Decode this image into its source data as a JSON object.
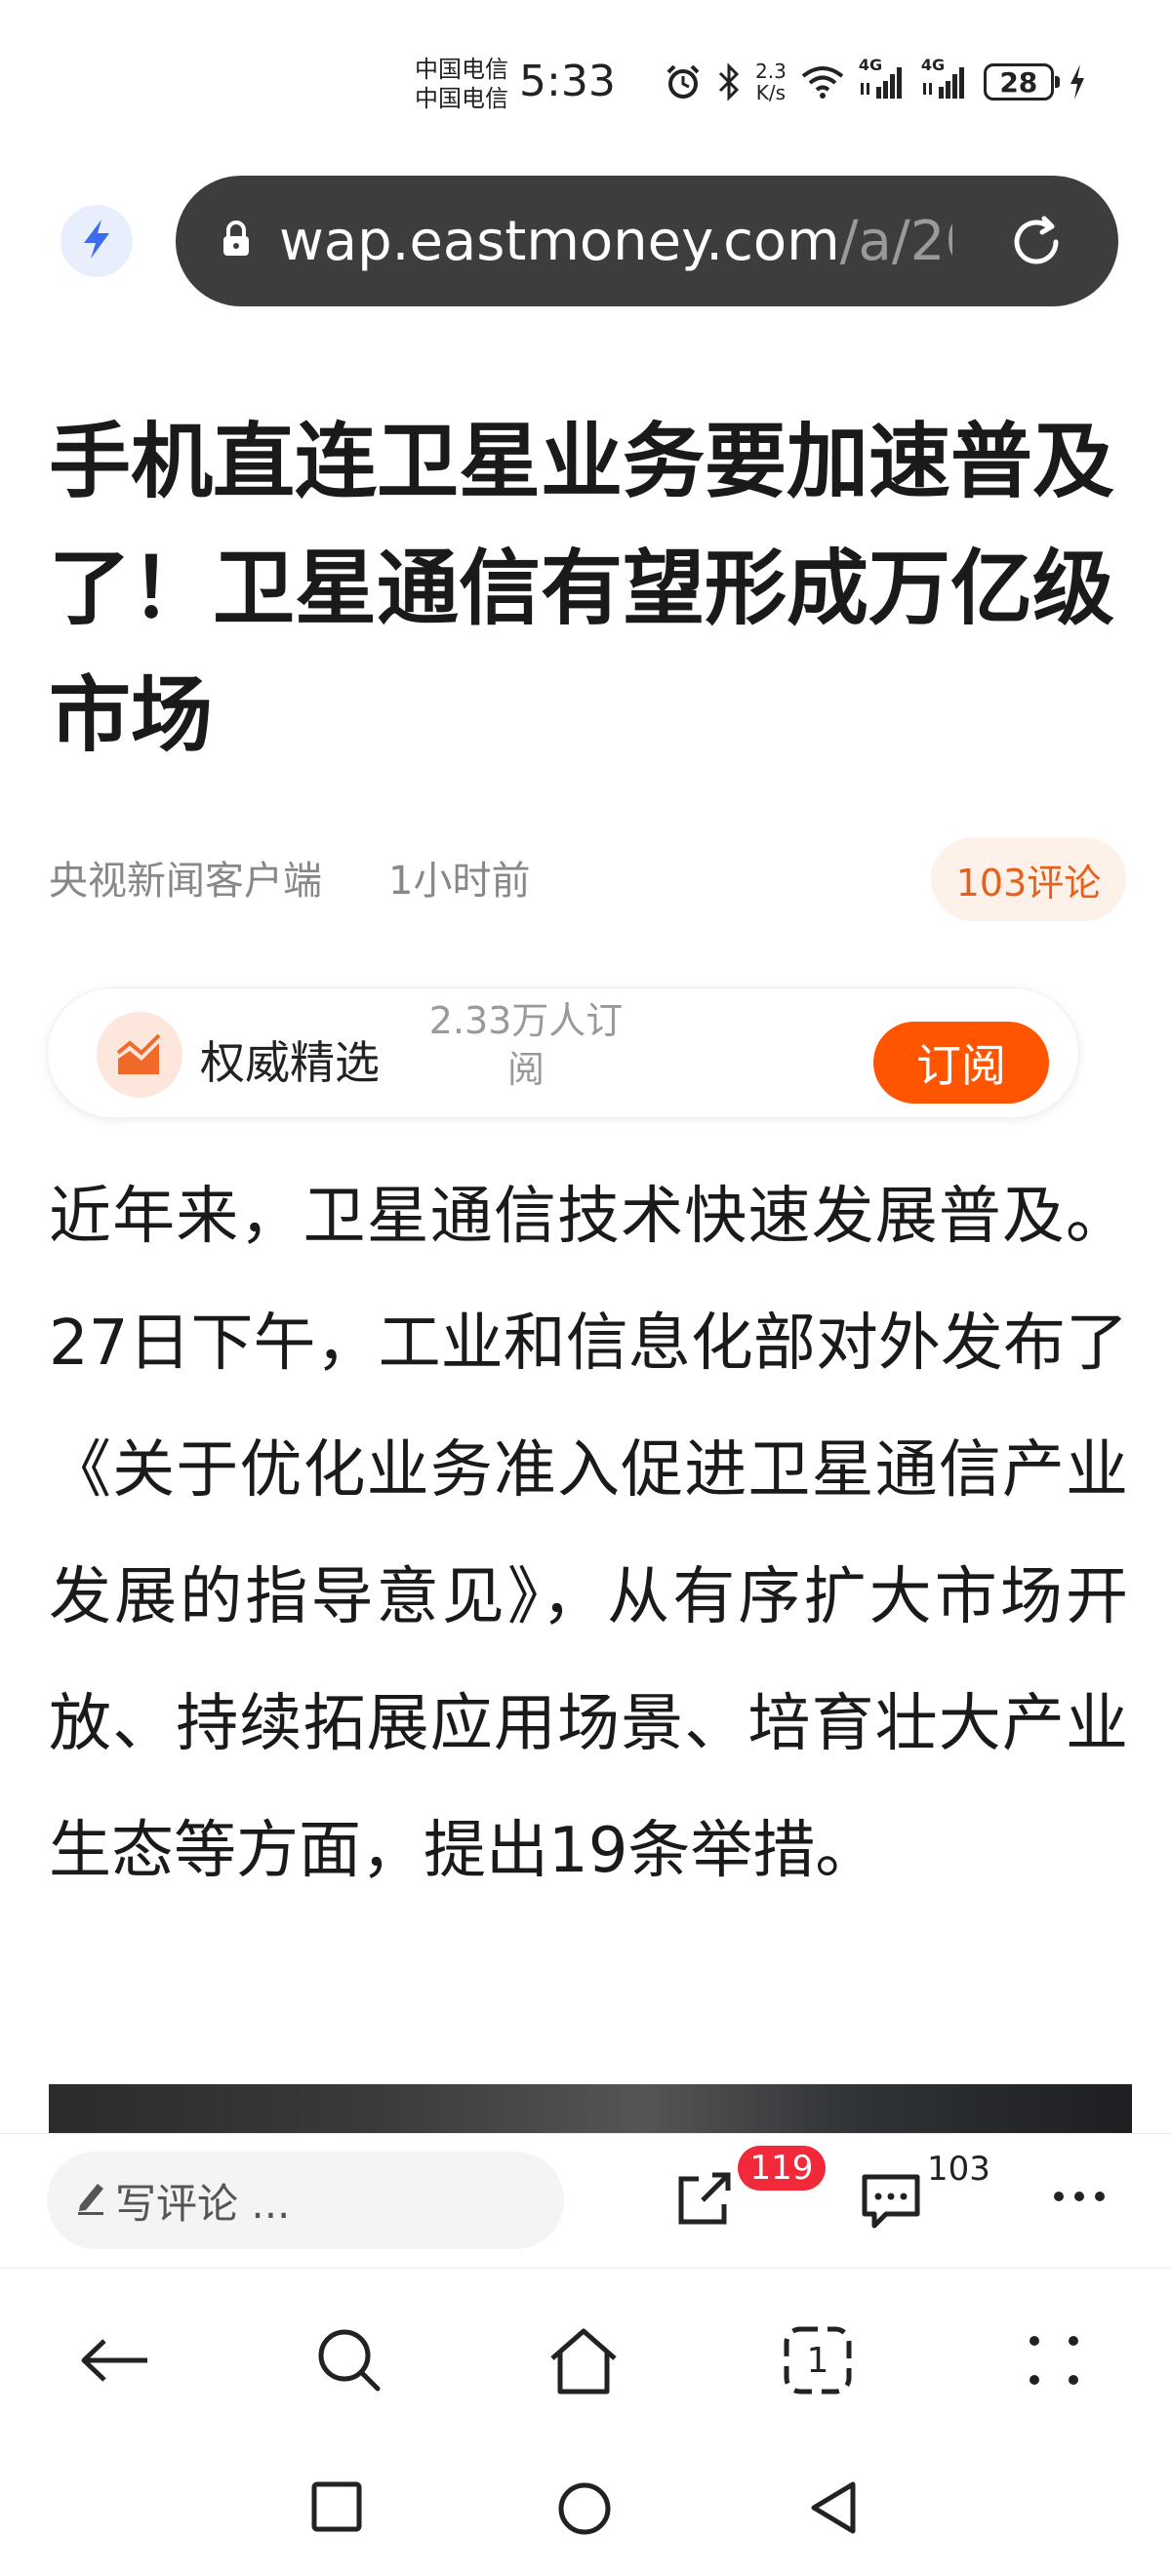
{
  "status_bar": {
    "carrier_1": "中国电信",
    "carrier_2": "中国电信",
    "time": "5:33",
    "net_speed_value": "2.3",
    "net_speed_unit": "K/s",
    "signal_1_label": "4G",
    "signal_2_label": "4G",
    "battery_level": "28",
    "icons": [
      "alarm-icon",
      "bluetooth-icon",
      "wifi-icon",
      "signal-icon",
      "signal-icon",
      "battery-icon",
      "charging-icon"
    ]
  },
  "address_bar": {
    "domain": "wap.eastmoney.com",
    "path": "/a/20",
    "icons": [
      "lightning-icon",
      "lock-icon",
      "reload-icon"
    ]
  },
  "article": {
    "title": "手机直连卫星业务要加速普及了！卫星通信有望形成万亿级市场",
    "source": "央视新闻客户端",
    "time_ago": "1小时前",
    "comments_label": "103评论",
    "channel": {
      "name": "权威精选",
      "subscribers": "2.33万人订阅",
      "subscribe_label": "订阅"
    },
    "body": "近年来，卫星通信技术快速发展普及。27日下午，工业和信息化部对外发布了《关于优化业务准入促进卫星通信产业发展的指导意见》，从有序扩大市场开放、持续拓展应用场景、培育壮大产业生态等方面，提出19条举措。"
  },
  "comment_bar": {
    "write_placeholder": "写评论 ...",
    "share_badge": "119",
    "comment_count": "103"
  },
  "browser_nav": {
    "tab_count": "1",
    "icons": [
      "back-arrow-icon",
      "search-icon",
      "home-icon",
      "tabs-icon",
      "menu-icon"
    ]
  },
  "system_nav": {
    "icons": [
      "recents-icon",
      "home-circle-icon",
      "back-triangle-icon"
    ]
  },
  "colors": {
    "accent_orange": "#ff5500",
    "comment_pill_text": "#e4621b",
    "badge_red": "#f2293a",
    "url_bar_bg": "#3d3d3d"
  }
}
